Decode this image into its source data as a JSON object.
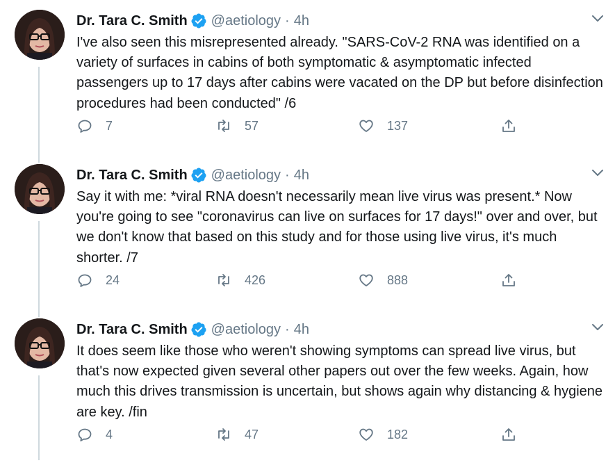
{
  "tweets": [
    {
      "name": "Dr. Tara C. Smith",
      "handle": "@aetiology",
      "separator": "·",
      "time": "4h",
      "text": "I've also seen this misrepresented already. \"SARS-CoV-2 RNA was identified on a variety of surfaces in cabins of both symptomatic & asymptomatic infected passengers up to 17 days after cabins were vacated on the DP but before disinfection procedures had been conducted\" /6",
      "replies": "7",
      "retweets": "57",
      "likes": "137"
    },
    {
      "name": "Dr. Tara C. Smith",
      "handle": "@aetiology",
      "separator": "·",
      "time": "4h",
      "text": "Say it with me: *viral RNA doesn't necessarily mean live virus was present.* Now you're going to see \"coronavirus can live on surfaces for 17 days!\" over and over, but we don't know that based on this study and for those using live virus, it's much shorter. /7",
      "replies": "24",
      "retweets": "426",
      "likes": "888"
    },
    {
      "name": "Dr. Tara C. Smith",
      "handle": "@aetiology",
      "separator": "·",
      "time": "4h",
      "text": "It does seem like those who weren't showing symptoms can spread live virus, but that's now expected given several other papers out over the few weeks. Again, how much this drives transmission is uncertain, but shows again why distancing & hygiene are key. /fin",
      "replies": "4",
      "retweets": "47",
      "likes": "182"
    }
  ],
  "icons": {
    "verified": "verified-badge-icon",
    "caret": "chevron-down-icon",
    "reply": "reply-icon",
    "retweet": "retweet-icon",
    "like": "heart-icon",
    "share": "share-icon"
  },
  "colors": {
    "text": "#14171a",
    "secondary": "#657786",
    "verified": "#1da1f2",
    "thread_line": "#cfd9de"
  }
}
